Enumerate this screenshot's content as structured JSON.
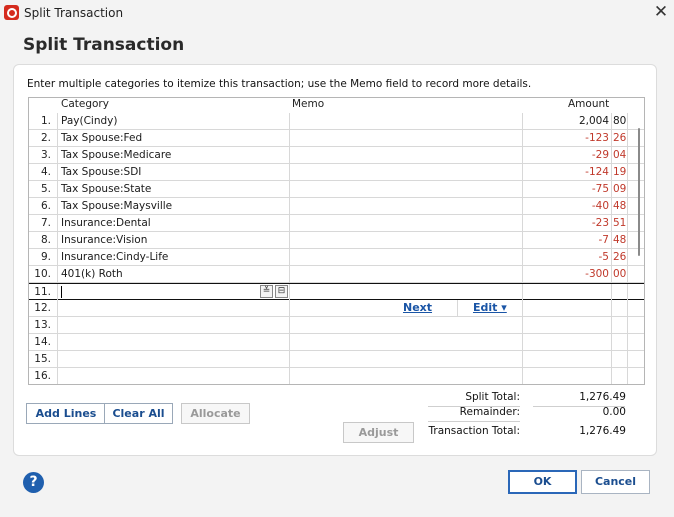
{
  "window": {
    "title": "Split Transaction",
    "close_glyph": "✕"
  },
  "dialog": {
    "heading": "Split Transaction",
    "instructions": "Enter multiple categories to itemize this transaction; use the Memo field to record more details."
  },
  "columns": {
    "category": "Category",
    "memo": "Memo",
    "amount": "Amount"
  },
  "rows": [
    {
      "num": "1.",
      "category": "Pay(Cindy)",
      "amount": "2,004",
      "cents": "80",
      "negative": false
    },
    {
      "num": "2.",
      "category": "Tax Spouse:Fed",
      "amount": "-123",
      "cents": "26",
      "negative": true
    },
    {
      "num": "3.",
      "category": "Tax Spouse:Medicare",
      "amount": "-29",
      "cents": "04",
      "negative": true
    },
    {
      "num": "4.",
      "category": "Tax Spouse:SDI",
      "amount": "-124",
      "cents": "19",
      "negative": true
    },
    {
      "num": "5.",
      "category": "Tax Spouse:State",
      "amount": "-75",
      "cents": "09",
      "negative": true
    },
    {
      "num": "6.",
      "category": "Tax Spouse:Maysville",
      "amount": "-40",
      "cents": "48",
      "negative": true
    },
    {
      "num": "7.",
      "category": "Insurance:Dental",
      "amount": "-23",
      "cents": "51",
      "negative": true
    },
    {
      "num": "8.",
      "category": "Insurance:Vision",
      "amount": "-7",
      "cents": "48",
      "negative": true
    },
    {
      "num": "9.",
      "category": "Insurance:Cindy-Life",
      "amount": "-5",
      "cents": "26",
      "negative": true
    },
    {
      "num": "10.",
      "category": "401(k) Roth",
      "amount": "-300",
      "cents": "00",
      "negative": true
    },
    {
      "num": "11.",
      "category": "",
      "amount": "",
      "cents": "",
      "negative": false
    },
    {
      "num": "12.",
      "category": "",
      "amount": "",
      "cents": "",
      "negative": false
    },
    {
      "num": "13.",
      "category": "",
      "amount": "",
      "cents": "",
      "negative": false
    },
    {
      "num": "14.",
      "category": "",
      "amount": "",
      "cents": "",
      "negative": false
    },
    {
      "num": "15.",
      "category": "",
      "amount": "",
      "cents": "",
      "negative": false
    },
    {
      "num": "16.",
      "category": "",
      "amount": "",
      "cents": "",
      "negative": false
    }
  ],
  "row_actions": {
    "next": "Next",
    "edit": "Edit ▾"
  },
  "buttons": {
    "add_lines": "Add Lines",
    "clear_all": "Clear All",
    "allocate": "Allocate",
    "adjust": "Adjust",
    "ok": "OK",
    "cancel": "Cancel",
    "help": "?"
  },
  "totals": {
    "split_total_label": "Split Total:",
    "split_total": "1,276.49",
    "remainder_label": "Remainder:",
    "remainder": "0.00",
    "transaction_total_label": "Transaction Total:",
    "transaction_total": "1,276.49"
  },
  "colors": {
    "negative": "#c0392b",
    "accent": "#1a4d8f"
  },
  "icons": {
    "app": "quicken-logo-icon",
    "close": "close-icon",
    "help": "help-icon"
  }
}
